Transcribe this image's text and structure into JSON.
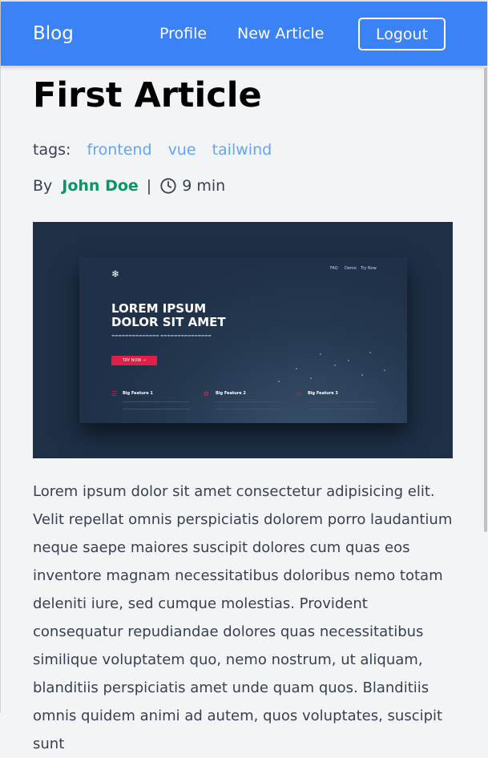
{
  "navbar": {
    "brand": "Blog",
    "links": [
      "Profile",
      "New Article"
    ],
    "logout_label": "Logout",
    "background_color": "#3b82f6"
  },
  "article": {
    "title": "First Article",
    "tags_label": "tags:",
    "tags": [
      "frontend",
      "vue",
      "tailwind"
    ],
    "by_label": "By",
    "author": "John Doe",
    "separator": "|",
    "read_time": "9 min",
    "clock_icon": "clock-icon",
    "body": "Lorem ipsum dolor sit amet consectetur adipisicing elit. Velit repellat omnis perspiciatis dolorem porro laudantium neque saepe maiores suscipit dolores cum quas eos inventore magnam necessitatibus doloribus nemo totam deleniti iure, sed cumque molestias. Provident consequatur repudiandae dolores quas necessitatibus similique voluptatem quo, nemo nostrum, ut aliquam, blanditiis perspiciatis amet unde quam quos. Blanditiis omnis quidem animi ad autem, quos voluptates, suscipit sunt"
  },
  "hero_image": {
    "logo_icon": "snowflake-icon",
    "nav": [
      "FAQ",
      "Demo",
      "Try Now"
    ],
    "headline_line1": "LOREM IPSUM",
    "headline_line2": "DOLOR SIT AMET",
    "button": "TRY NOW →",
    "features": [
      "Big Feature 1",
      "Big Feature 2",
      "Big Feature 3"
    ],
    "accent_color": "#e11d48"
  },
  "colors": {
    "tag": "#60a5fa",
    "author": "#059669"
  }
}
